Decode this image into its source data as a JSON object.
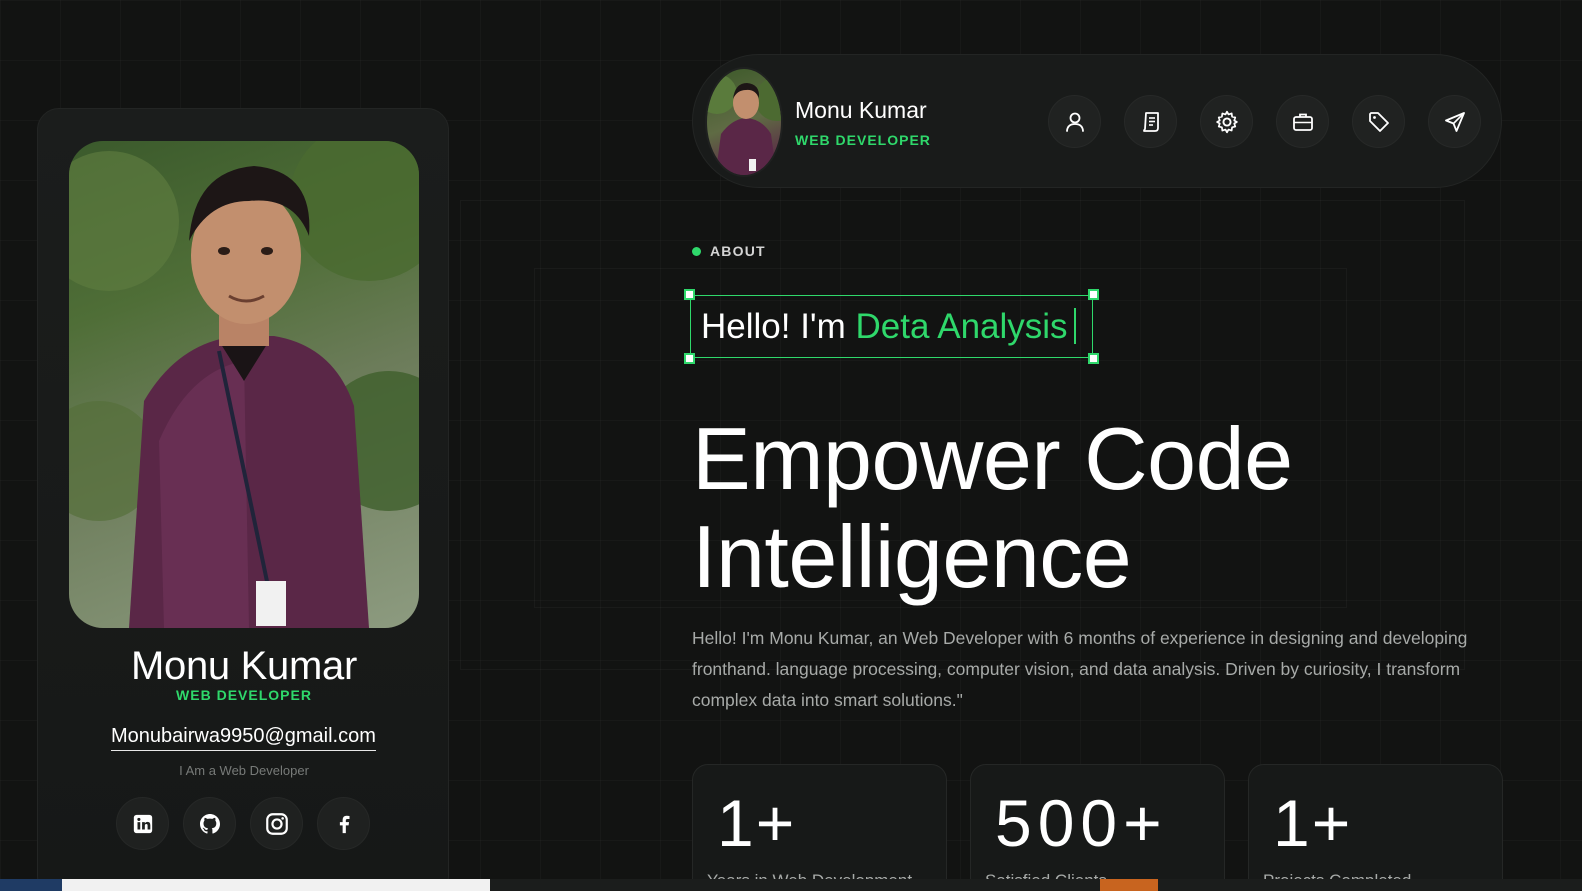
{
  "profile_card": {
    "name": "Monu Kumar",
    "role": "WEB DEVELOPER",
    "email": "Monubairwa9950@gmail.com",
    "tagline": "I Am a Web Developer",
    "socials": [
      "linkedin-icon",
      "github-icon",
      "instagram-icon",
      "facebook-icon"
    ]
  },
  "nav": {
    "name": "Monu Kumar",
    "role": "WEB DEVELOPER",
    "icons": [
      "user-icon",
      "resume-icon",
      "gear-icon",
      "briefcase-icon",
      "tag-icon",
      "send-icon"
    ]
  },
  "main": {
    "section_label": "ABOUT",
    "hello_prefix": "Hello! I'm ",
    "hello_accent": "Deta Analysis",
    "title_line1": "Empower Code",
    "title_line2": "Intelligence",
    "intro": "Hello! I'm Monu Kumar, an Web Developer with 6 months of experience in designing and developing fronthand. language processing, computer vision, and data analysis. Driven by curiosity, I transform complex data into smart solutions.\""
  },
  "stats": [
    {
      "value": "1+",
      "label": "Years in Web Development"
    },
    {
      "value": "500+",
      "label": "Satisfied Clients"
    },
    {
      "value": "1+",
      "label": "Projects Completed"
    }
  ],
  "colors": {
    "accent": "#2fd86b",
    "background": "#121312",
    "card": "#1b1d1c"
  }
}
